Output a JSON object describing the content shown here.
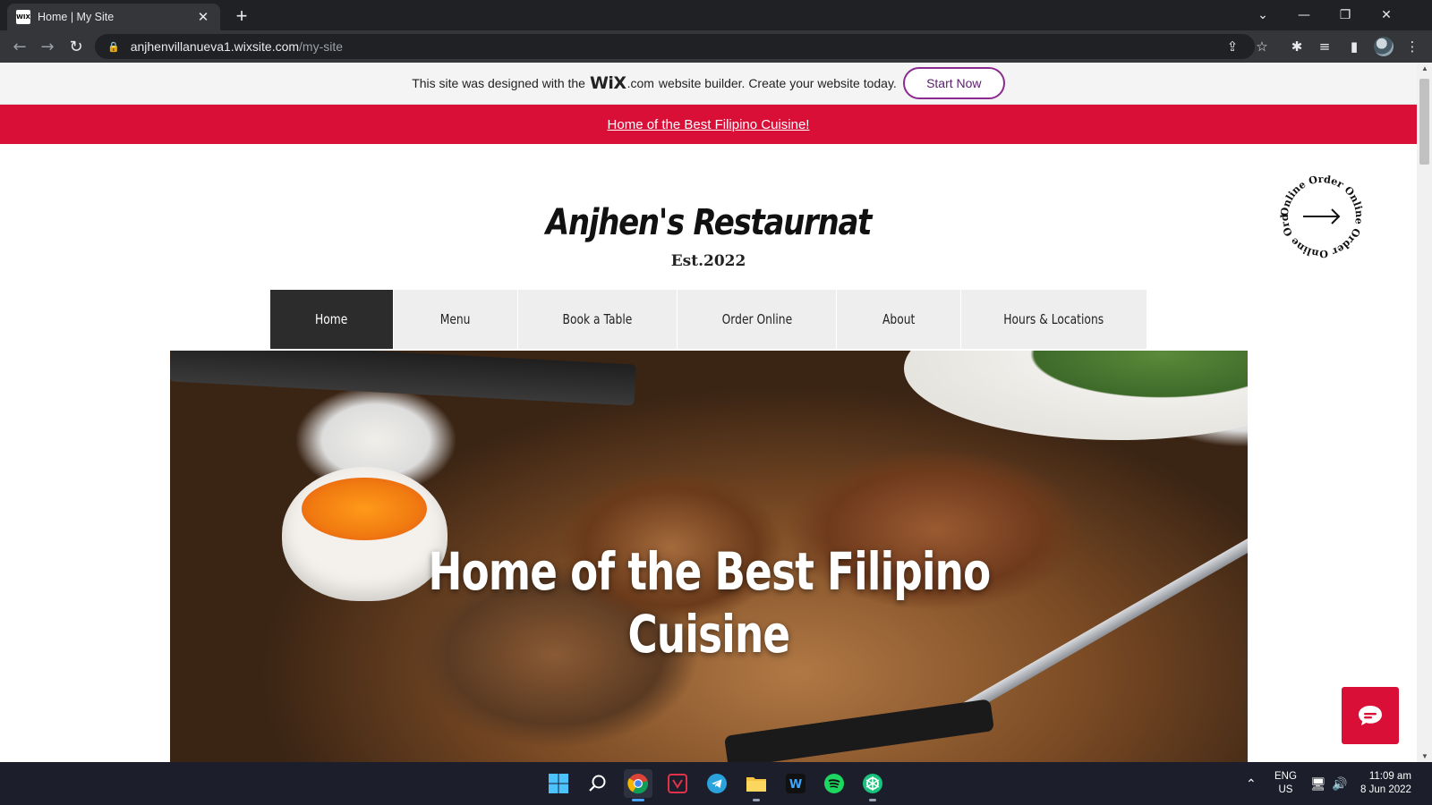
{
  "browser": {
    "tab_title": "Home | My Site",
    "favicon_text": "WIX",
    "url_domain": "anjhenvillanueva1.wixsite.com",
    "url_path": "/my-site"
  },
  "wix_banner": {
    "text_before": "This site was designed with the",
    "logo": "WiX",
    "logo_suffix": ".com",
    "text_after": "website builder. Create your website today.",
    "cta": "Start Now"
  },
  "promo_bar": {
    "link": "Home of the Best Filipino Cuisine!"
  },
  "site": {
    "name": "Anjhen's Restaurnat",
    "tagline": "Est.2022",
    "order_badge_text": "Online Order Online Order Online Order"
  },
  "nav": {
    "items": [
      {
        "label": "Home",
        "active": true
      },
      {
        "label": "Menu",
        "active": false
      },
      {
        "label": "Book a Table",
        "active": false
      },
      {
        "label": "Order Online",
        "active": false
      },
      {
        "label": "About",
        "active": false
      },
      {
        "label": "Hours & Locations",
        "active": false
      }
    ]
  },
  "hero": {
    "title_line1": "Home of the Best Filipino",
    "title_line2": "Cuisine"
  },
  "colors": {
    "accent": "#d90f38",
    "nav_active": "#2c2c2c",
    "wix_cta": "#8b2a8f"
  },
  "taskbar": {
    "apps": [
      "windows-start-icon",
      "search-icon",
      "chrome-icon",
      "vivaldi-icon",
      "telegram-icon",
      "file-explorer-icon",
      "webtoon-icon",
      "spotify-icon",
      "chatgpt-icon"
    ],
    "lang_line1": "ENG",
    "lang_line2": "US",
    "time": "11:09 am",
    "date": "8 Jun 2022"
  }
}
